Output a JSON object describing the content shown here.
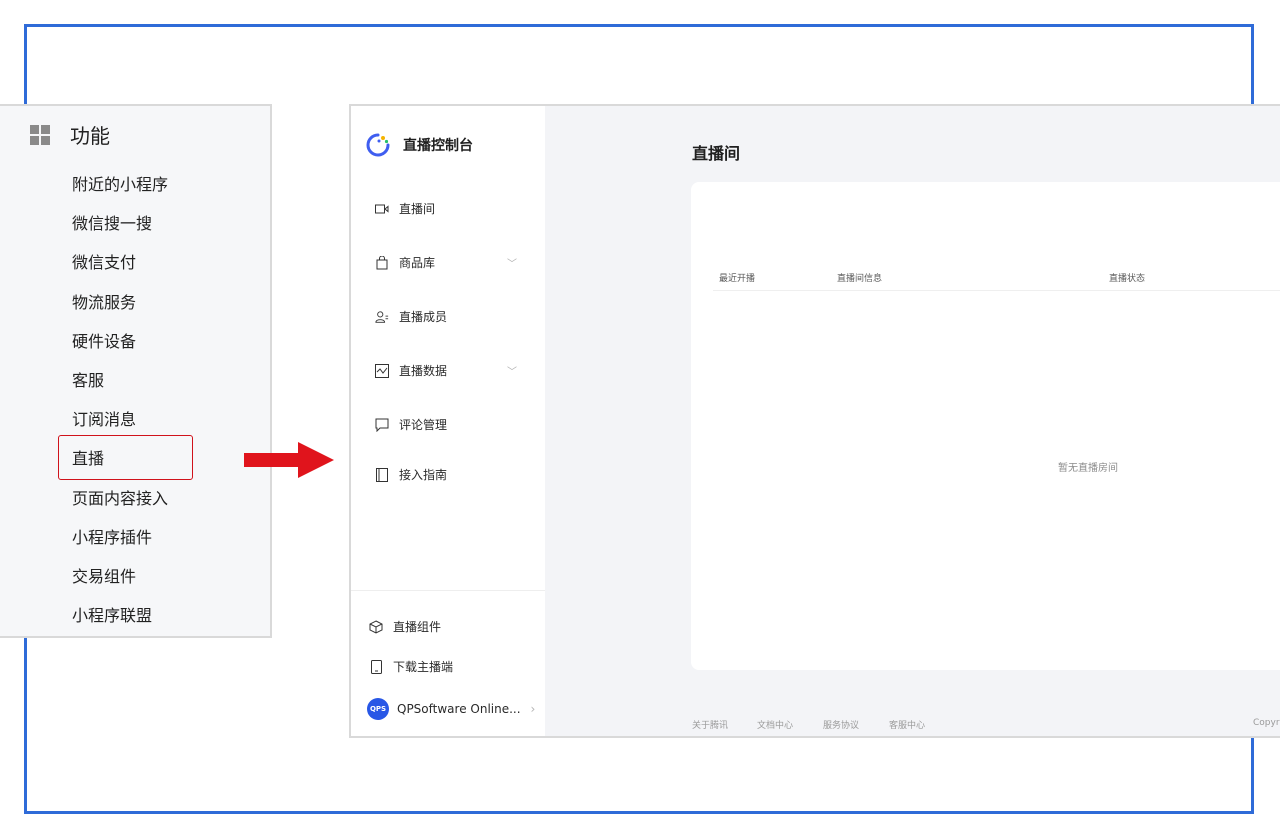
{
  "function_panel": {
    "title": "功能",
    "items": [
      "附近的小程序",
      "微信搜一搜",
      "微信支付",
      "物流服务",
      "硬件设备",
      "客服",
      "订阅消息",
      "直播",
      "页面内容接入",
      "小程序插件",
      "交易组件",
      "小程序联盟"
    ],
    "highlighted": "直播"
  },
  "console": {
    "brand_title": "直播控制台",
    "nav": [
      {
        "label": "直播间",
        "icon": "video-camera-icon"
      },
      {
        "label": "商品库",
        "icon": "shopping-bag-icon",
        "expandable": true
      },
      {
        "label": "直播成员",
        "icon": "members-icon"
      },
      {
        "label": "直播数据",
        "icon": "chart-icon",
        "expandable": true
      },
      {
        "label": "评论管理",
        "icon": "comment-icon"
      },
      {
        "label": "接入指南",
        "icon": "book-icon"
      }
    ],
    "bottom_nav": [
      {
        "label": "直播组件",
        "icon": "cube-icon"
      },
      {
        "label": "下载主播端",
        "icon": "phone-icon"
      }
    ],
    "account": {
      "logo_text": "QPS",
      "name": "QPSoftware Online..."
    },
    "page_title": "直播间",
    "table_headers": [
      "最近开播",
      "直播间信息",
      "直播状态"
    ],
    "empty_text": "暂无直播房间",
    "footer_links": [
      "关于腾讯",
      "文档中心",
      "服务协议",
      "客服中心"
    ],
    "footer_right": "Copyri"
  },
  "colors": {
    "highlight": "#d0121b",
    "arrow": "#e0141c",
    "frame": "#2f6bd8",
    "brand_blue": "#3f5ef0"
  }
}
